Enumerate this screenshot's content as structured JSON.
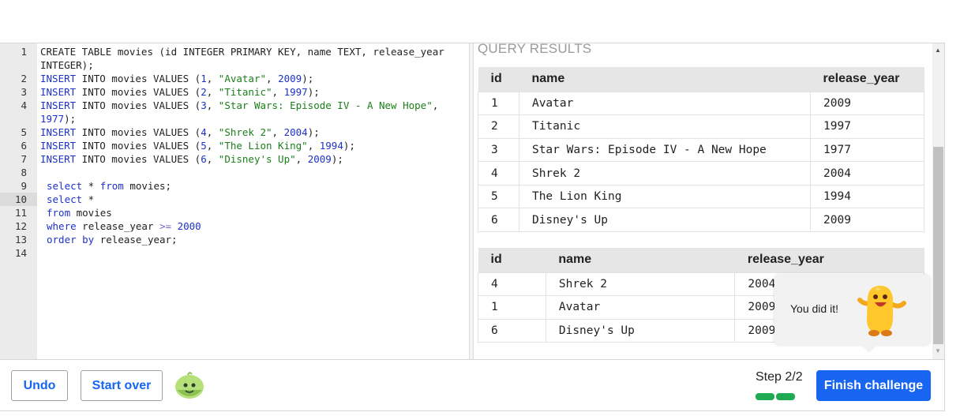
{
  "editor": {
    "lines": [
      {
        "n": "1",
        "text": "CREATE TABLE movies (id INTEGER PRIMARY KEY, name TEXT, release_year"
      },
      {
        "n": "",
        "text": "INTEGER);"
      },
      {
        "n": "2",
        "text": "INSERT INTO movies VALUES (1, \"Avatar\", 2009);"
      },
      {
        "n": "3",
        "text": "INSERT INTO movies VALUES (2, \"Titanic\", 1997);"
      },
      {
        "n": "4",
        "text": "INSERT INTO movies VALUES (3, \"Star Wars: Episode IV - A New Hope\","
      },
      {
        "n": "",
        "text": "1977);"
      },
      {
        "n": "5",
        "text": "INSERT INTO movies VALUES (4, \"Shrek 2\", 2004);"
      },
      {
        "n": "6",
        "text": "INSERT INTO movies VALUES (5, \"The Lion King\", 1994);"
      },
      {
        "n": "7",
        "text": "INSERT INTO movies VALUES (6, \"Disney's Up\", 2009);"
      },
      {
        "n": "8",
        "text": ""
      },
      {
        "n": "9",
        "text": "select * from movies;"
      },
      {
        "n": "10",
        "text": "select *"
      },
      {
        "n": "11",
        "text": "from movies"
      },
      {
        "n": "12",
        "text": "where release_year >= 2000"
      },
      {
        "n": "13",
        "text": "order by release_year;"
      },
      {
        "n": "14",
        "text": ""
      }
    ]
  },
  "results": {
    "title": "QUERY RESULTS",
    "table1": {
      "headers": [
        "id",
        "name",
        "release_year"
      ],
      "rows": [
        [
          "1",
          "Avatar",
          "2009"
        ],
        [
          "2",
          "Titanic",
          "1997"
        ],
        [
          "3",
          "Star Wars: Episode IV - A New Hope",
          "1977"
        ],
        [
          "4",
          "Shrek 2",
          "2004"
        ],
        [
          "5",
          "The Lion King",
          "1994"
        ],
        [
          "6",
          "Disney's Up",
          "2009"
        ]
      ]
    },
    "table2": {
      "headers": [
        "id",
        "name",
        "release_year"
      ],
      "rows": [
        [
          "4",
          "Shrek 2",
          "2004"
        ],
        [
          "1",
          "Avatar",
          "2009"
        ],
        [
          "6",
          "Disney's Up",
          "2009"
        ]
      ]
    }
  },
  "tooltip": {
    "text": "You did it!"
  },
  "bottombar": {
    "undo_label": "Undo",
    "startover_label": "Start over",
    "step_label": "Step 2/2",
    "finish_label": "Finish challenge"
  },
  "colors": {
    "accent": "#1865f2",
    "progress": "#1fab54",
    "keyword": "#1d32c9",
    "string": "#1a7f1a"
  }
}
